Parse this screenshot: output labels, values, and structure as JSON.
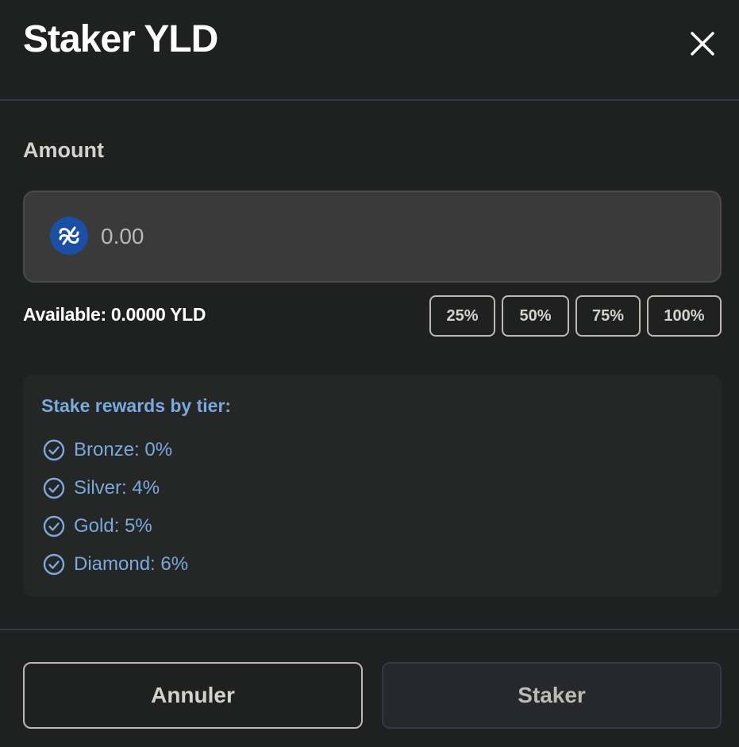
{
  "modal": {
    "title": "Staker YLD",
    "close_icon": "close-icon"
  },
  "amount": {
    "label": "Amount",
    "placeholder": "0.00",
    "value": "",
    "token_icon": "yld-token-icon"
  },
  "available": {
    "text": "Available: 0.0000 YLD"
  },
  "percent_buttons": [
    "25%",
    "50%",
    "75%",
    "100%"
  ],
  "rewards": {
    "title": "Stake rewards by tier:",
    "tiers": [
      {
        "label": "Bronze: 0%",
        "icon": "check-circle-icon"
      },
      {
        "label": "Silver: 4%",
        "icon": "check-circle-icon"
      },
      {
        "label": "Gold: 5%",
        "icon": "check-circle-icon"
      },
      {
        "label": "Diamond: 6%",
        "icon": "check-circle-icon"
      }
    ]
  },
  "footer": {
    "cancel_label": "Annuler",
    "stake_label": "Staker"
  },
  "colors": {
    "background": "#1f2020",
    "accent_blue": "#7aa9dd",
    "token_blue": "#1b4fa6",
    "divider": "#343a45"
  }
}
